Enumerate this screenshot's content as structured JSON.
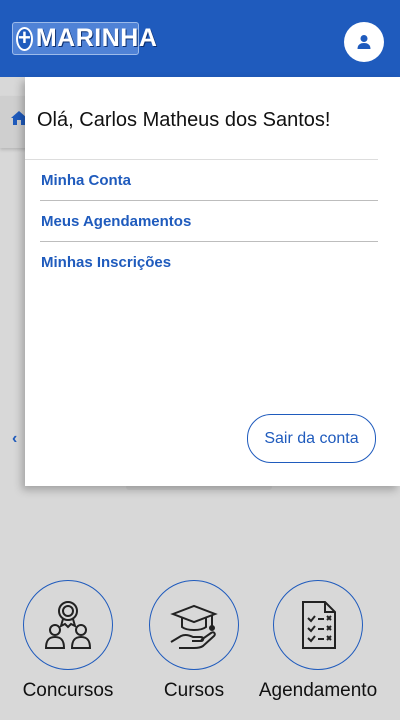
{
  "header": {
    "logo_symbol": "+",
    "logo_text": "MARINHA",
    "user_icon": "user-icon",
    "brand_color": "#1f5bbd"
  },
  "background": {
    "home_icon": "home-icon",
    "back_icon": "chevron-left-icon",
    "back_glyph": "‹"
  },
  "menu": {
    "greeting_prefix": "Olá,",
    "user_name": "Carlos Matheus dos Santos!",
    "items": [
      {
        "label": "Minha Conta"
      },
      {
        "label": "Meus Agendamentos"
      },
      {
        "label": "Minhas Inscrições"
      }
    ],
    "logout_label": "Sair da conta"
  },
  "shortcuts": [
    {
      "label": "Concursos",
      "icon": "contest-award-icon"
    },
    {
      "label": "Cursos",
      "icon": "graduation-cap-hand-icon"
    },
    {
      "label": "Agendamento",
      "icon": "checklist-document-icon"
    }
  ]
}
